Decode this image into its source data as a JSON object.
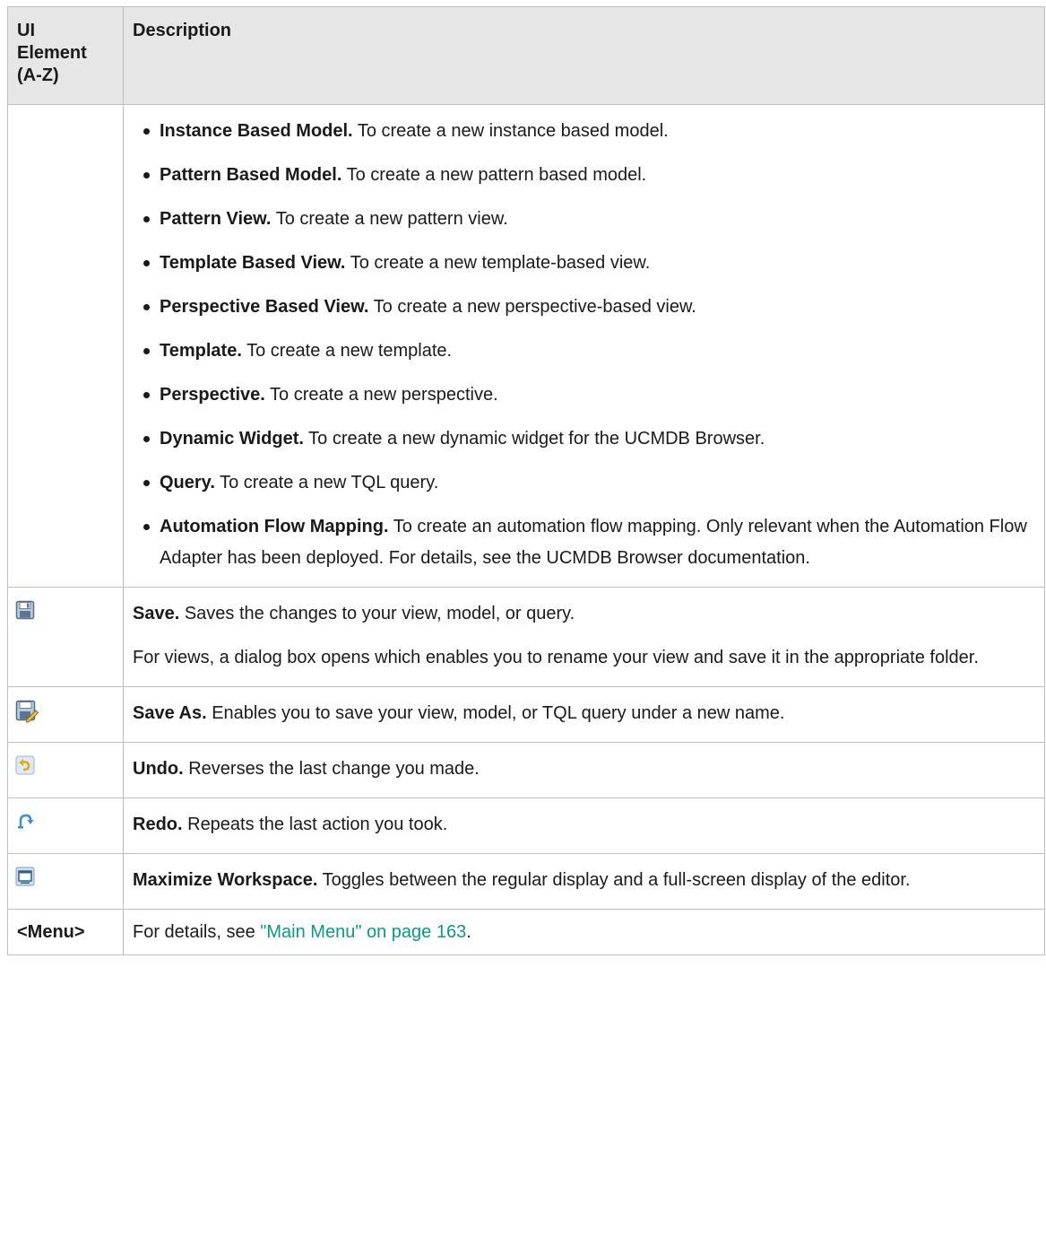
{
  "table": {
    "header": {
      "col1": [
        "UI",
        "Element",
        "(A-Z)"
      ],
      "col2": "Description"
    },
    "new_menu_items": [
      {
        "label": "Instance Based Model.",
        "text": " To create a new instance based model."
      },
      {
        "label": "Pattern Based Model.",
        "text": " To create a new pattern based model."
      },
      {
        "label": "Pattern View.",
        "text": " To create a new pattern view."
      },
      {
        "label": "Template Based View.",
        "text": " To create a new template-based view."
      },
      {
        "label": "Perspective Based View.",
        "text": " To create a new perspective-based view."
      },
      {
        "label": "Template.",
        "text": " To create a new template."
      },
      {
        "label": "Perspective.",
        "text": " To create a new perspective."
      },
      {
        "label": "Dynamic Widget.",
        "text": " To create a new dynamic widget for the UCMDB Browser."
      },
      {
        "label": "Query.",
        "text": " To create a new TQL query."
      },
      {
        "label": "Automation Flow Mapping.",
        "text": " To create an automation flow mapping. Only relevant when the Automation Flow Adapter has been deployed. For details, see the UCMDB Browser documentation."
      }
    ],
    "rows": {
      "save": {
        "icon": "save-icon",
        "label": "Save.",
        "text": " Saves the changes to your view, model, or query.",
        "extra": "For views, a dialog box opens which enables you to rename your view and save it in the appropriate folder."
      },
      "save_as": {
        "icon": "save-as-icon",
        "label": "Save As.",
        "text": " Enables you to save your view, model, or TQL query under a new name."
      },
      "undo": {
        "icon": "undo-icon",
        "label": "Undo.",
        "text": " Reverses the last change you made."
      },
      "redo": {
        "icon": "redo-icon",
        "label": "Redo.",
        "text": " Repeats the last action you took."
      },
      "maximize": {
        "icon": "maximize-workspace-icon",
        "label": "Maximize Workspace.",
        "text": " Toggles between the regular display and a full-screen display of the editor."
      },
      "menu": {
        "label": "<Menu>",
        "text_before": "For details, see ",
        "link": "\"Main Menu\" on page 163",
        "text_after": "."
      }
    }
  }
}
